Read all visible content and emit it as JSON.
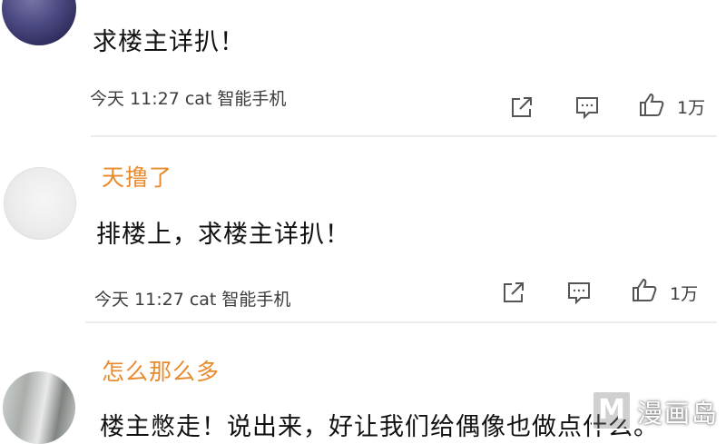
{
  "comments": [
    {
      "username": "",
      "text": "求楼主详扒！",
      "meta": "今天 11:27 cat 智能手机",
      "likes": "1万"
    },
    {
      "username": "天撸了",
      "text": "排楼上，求楼主详扒！",
      "meta": "今天 11:27 cat 智能手机",
      "likes": "1万"
    },
    {
      "username": "怎么那么多",
      "text": "楼主憋走！说出来，好让我们给偶像也做点什么。"
    }
  ],
  "icons": {
    "share": "share-icon",
    "comment": "comment-icon",
    "like": "thumbs-up-icon"
  },
  "colors": {
    "username": "#e98a2c",
    "text": "#111111",
    "meta": "#3c3c3c",
    "divider": "#ececec"
  },
  "watermark": {
    "badge": "M",
    "text": "漫画岛"
  }
}
